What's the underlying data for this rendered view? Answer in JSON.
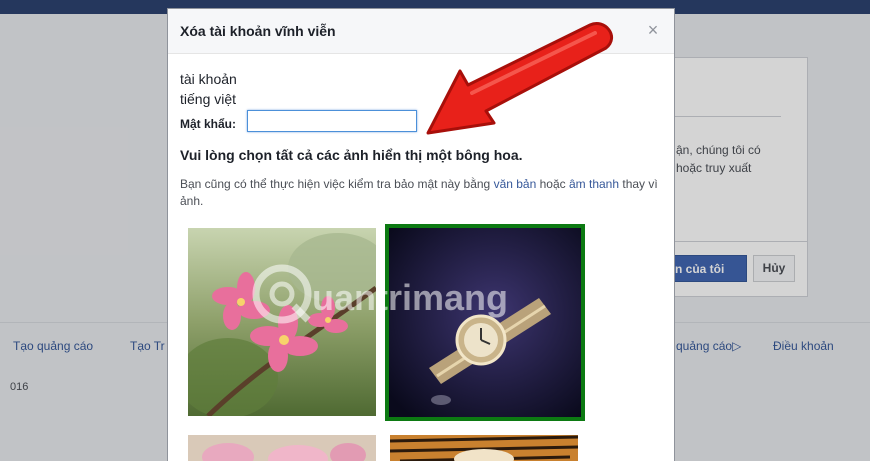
{
  "background": {
    "side_text_line1": "ận, chúng tôi có",
    "side_text_line2": "hoặc truy xuất",
    "confirm_label": "n của tôi",
    "cancel_label": "Hủy",
    "footer_links": [
      "Tạo quảng cáo",
      "Tạo Tr",
      "quảng cáo",
      "Điều khoản"
    ],
    "adchoices_glyph": "▷",
    "copyright": "016"
  },
  "dialog": {
    "title": "Xóa tài khoản vĩnh viễn",
    "close_glyph": "×",
    "account_line1": "tài khoản",
    "account_line2": "tiếng việt",
    "password_label": "Mật khẩu:",
    "password_value": "",
    "captcha_instruction": "Vui lòng chọn tất cả các ảnh hiển thị một bông hoa.",
    "note_prefix": "Bạn cũng có thể thực hiện việc kiểm tra bảo mật này bằng",
    "note_link_text": "văn bản",
    "note_middle": "hoặc",
    "note_link_audio": "âm thanh",
    "note_suffix": "thay vì ảnh."
  },
  "captcha_images": [
    {
      "subject": "pink-flower-image",
      "selected": false
    },
    {
      "subject": "wristwatch-image",
      "selected": true
    },
    {
      "subject": "pink-flower-image",
      "selected": false
    },
    {
      "subject": "tiger-image",
      "selected": false
    }
  ],
  "watermark_text": "uantrimang",
  "colors": {
    "topbar": "#2d4370",
    "link": "#365899",
    "primary_button": "#4267b2",
    "selection_border": "#0c7a12",
    "arrow": "#e8211a"
  }
}
